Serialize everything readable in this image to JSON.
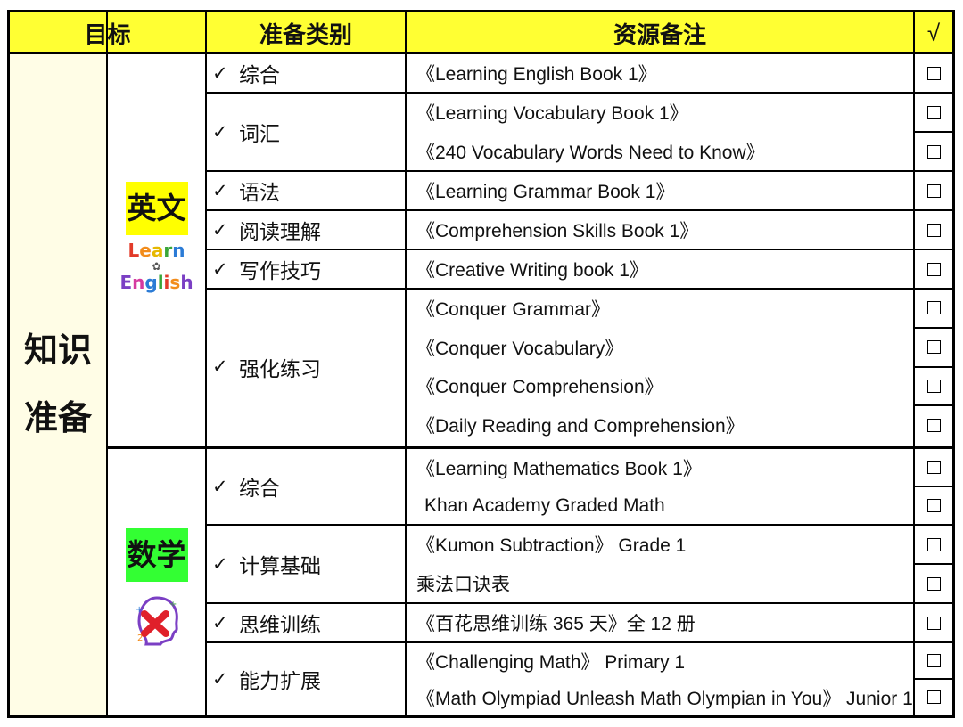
{
  "header": {
    "col_target": "目标",
    "col_category": "准备类别",
    "col_resources": "资源备注",
    "col_check": "√"
  },
  "colors": {
    "header_bg": "#ffff33",
    "english_label_bg": "#ffff00",
    "math_label_bg": "#33ff33",
    "target_bg": "#fffde6"
  },
  "target": {
    "line1": "知识",
    "line2": "准备"
  },
  "english": {
    "label": "英文",
    "logo_word1": "Learn",
    "logo_word2": "English",
    "categories": [
      {
        "tick": "✓",
        "name": "综合",
        "resources": [
          "《Learning English Book 1》"
        ]
      },
      {
        "tick": "✓",
        "name": "词汇",
        "resources": [
          "《Learning Vocabulary Book 1》",
          "《240 Vocabulary Words Need to Know》"
        ]
      },
      {
        "tick": "✓",
        "name": "语法",
        "resources": [
          "《Learning Grammar Book 1》"
        ]
      },
      {
        "tick": "✓",
        "name": "阅读理解",
        "resources": [
          "《Comprehension Skills Book 1》"
        ]
      },
      {
        "tick": "✓",
        "name": "写作技巧",
        "resources": [
          "《Creative Writing book 1》"
        ]
      },
      {
        "tick": "✓",
        "name": "强化练习",
        "resources": [
          "《Conquer Grammar》",
          "《Conquer Vocabulary》",
          "《Conquer Comprehension》",
          "《Daily Reading and Comprehension》"
        ]
      }
    ]
  },
  "math": {
    "label": "数学",
    "logo_icon": "math-head-icon",
    "categories": [
      {
        "tick": "✓",
        "name": "综合",
        "resources": [
          "《Learning Mathematics Book 1》",
          "Khan Academy Graded Math"
        ]
      },
      {
        "tick": "✓",
        "name": "计算基础",
        "resources": [
          "《Kumon Subtraction》 Grade 1",
          "乘法口诀表"
        ]
      },
      {
        "tick": "✓",
        "name": "思维训练",
        "resources": [
          "《百花思维训练 365 天》全 12 册"
        ]
      },
      {
        "tick": "✓",
        "name": "能力扩展",
        "resources": [
          "《Challenging Math》 Primary 1",
          "《Math Olympiad Unleash Math Olympian in You》 Junior 1"
        ]
      }
    ]
  }
}
